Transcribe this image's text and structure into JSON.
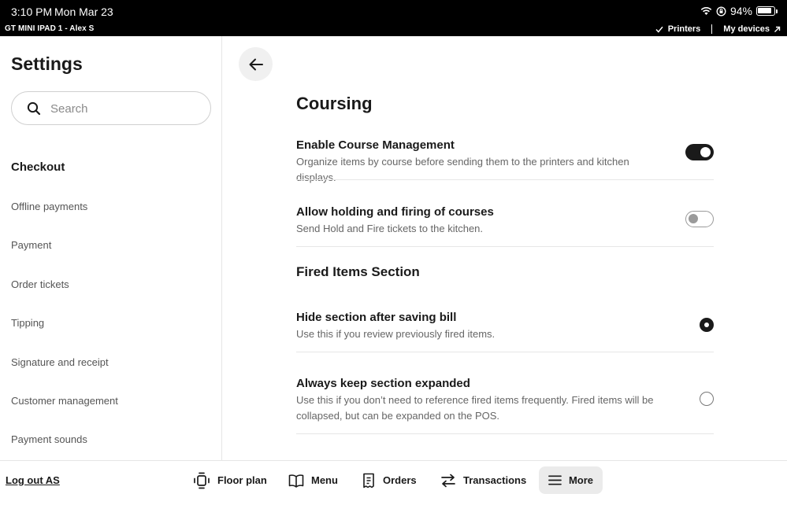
{
  "status_bar": {
    "time": "3:10 PM",
    "date": "Mon Mar 23",
    "battery": "94%",
    "device": "GT MINI IPAD 1 - Alex S",
    "printers_label": "Printers",
    "my_devices_label": "My devices"
  },
  "sidebar": {
    "title": "Settings",
    "search_placeholder": "Search",
    "section_heading": "Checkout",
    "items": [
      {
        "label": "Offline payments"
      },
      {
        "label": "Payment"
      },
      {
        "label": "Order tickets"
      },
      {
        "label": "Tipping"
      },
      {
        "label": "Signature and receipt"
      },
      {
        "label": "Customer management"
      },
      {
        "label": "Payment sounds"
      }
    ]
  },
  "content": {
    "title": "Coursing",
    "course_management": {
      "title": "Enable Course Management",
      "description": "Organize items by course before sending them to the printers and kitchen displays.",
      "enabled": true
    },
    "hold_fire": {
      "title": "Allow holding and firing of courses",
      "description": "Send Hold and Fire tickets to the kitchen.",
      "enabled": false
    },
    "fired_section": {
      "title": "Fired Items Section",
      "options": [
        {
          "title": "Hide section after saving bill",
          "description": "Use this if you review previously fired items.",
          "selected": true
        },
        {
          "title": "Always keep section expanded",
          "description": "Use this if you don’t need to reference fired items frequently. Fired items will be collapsed, but can be expanded on the POS.",
          "selected": false
        }
      ]
    }
  },
  "bottom_bar": {
    "logout_label": "Log out AS",
    "nav": [
      {
        "label": "Floor plan",
        "icon": "floor-plan-icon"
      },
      {
        "label": "Menu",
        "icon": "menu-book-icon"
      },
      {
        "label": "Orders",
        "icon": "orders-icon"
      },
      {
        "label": "Transactions",
        "icon": "transactions-icon"
      },
      {
        "label": "More",
        "icon": "hamburger-icon",
        "active": true
      }
    ]
  }
}
